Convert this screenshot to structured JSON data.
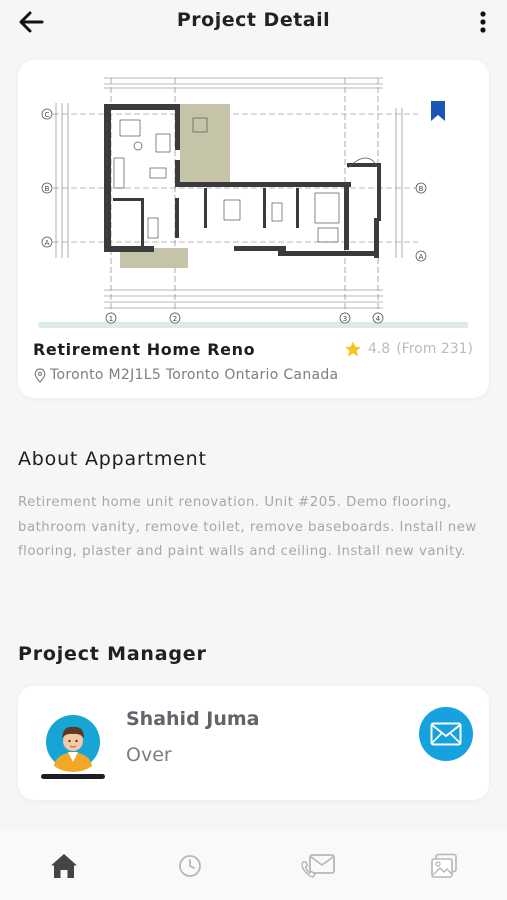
{
  "header": {
    "title": "Project Detail",
    "back_icon": "arrow-left-icon",
    "more_icon": "more-vertical-icon"
  },
  "project": {
    "name": "Retirement Home Reno",
    "rating": "4.8",
    "rating_count": "(From 231)",
    "location": "Toronto M2J1L5 Toronto Ontario Canada",
    "bookmark_icon": "bookmark-icon",
    "image_icon": "floor-plan-image"
  },
  "about": {
    "title": "About Appartment",
    "text": "Retirement home unit renovation. Unit #205. Demo flooring, bathroom vanity, remove toilet, remove baseboards.  Install new flooring, plaster and paint walls and ceiling. Install new vanity."
  },
  "project_manager": {
    "section_title": "Project Manager",
    "name": "Shahid Juma",
    "role": "Over",
    "avatar_icon": "avatar-icon",
    "message_icon": "envelope-icon"
  },
  "bottom_nav": {
    "items": [
      {
        "icon": "home-icon",
        "active": true
      },
      {
        "icon": "clock-icon",
        "active": false
      },
      {
        "icon": "phone-mail-icon",
        "active": false
      },
      {
        "icon": "gallery-icon",
        "active": false
      }
    ]
  },
  "colors": {
    "accent": "#16a2de",
    "bookmark": "#1a56b4",
    "star": "#f5c518",
    "background": "#f6f6f6",
    "nav_active": "#444444",
    "nav_inactive": "#b5b7ba"
  }
}
